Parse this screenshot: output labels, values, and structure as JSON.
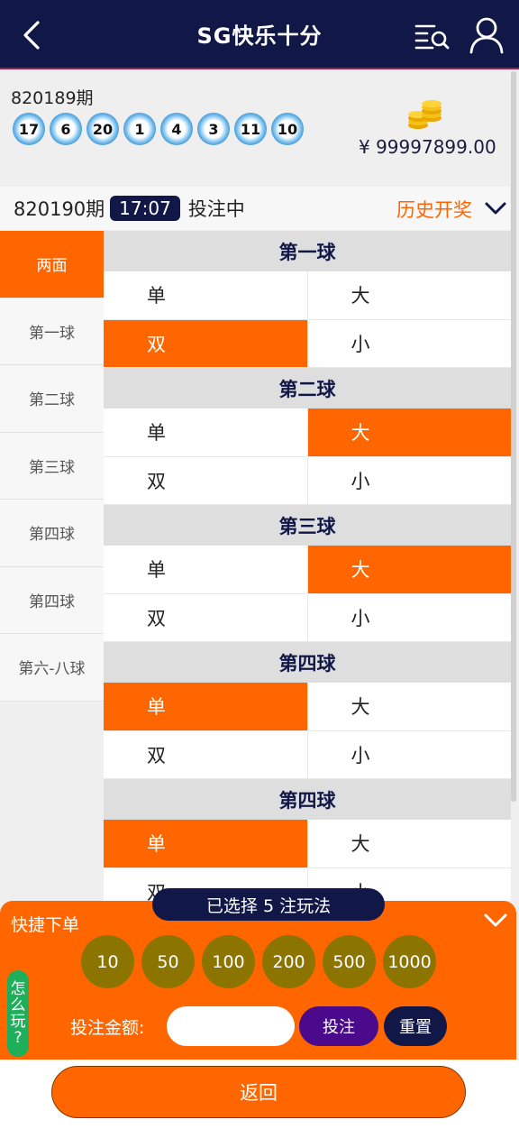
{
  "header": {
    "title": "SG快乐十分"
  },
  "last_draw": {
    "issue": "820189期",
    "balls": [
      "17",
      "6",
      "20",
      "1",
      "4",
      "3",
      "11",
      "10"
    ],
    "balance": "¥ 99997899.00"
  },
  "current": {
    "issue": "820190期",
    "timer": "17:07",
    "status": "投注中",
    "history_label": "历史开奖"
  },
  "nav": {
    "items": [
      {
        "label": "两面",
        "active": true
      },
      {
        "label": "第一球",
        "active": false
      },
      {
        "label": "第二球",
        "active": false
      },
      {
        "label": "第三球",
        "active": false
      },
      {
        "label": "第四球",
        "active": false
      },
      {
        "label": "第四球",
        "active": false
      },
      {
        "label": "第六-八球",
        "active": false
      }
    ]
  },
  "groups": [
    {
      "title": "第一球",
      "rows": [
        [
          {
            "label": "单",
            "selected": false
          },
          {
            "label": "大",
            "selected": false
          }
        ],
        [
          {
            "label": "双",
            "selected": true
          },
          {
            "label": "小",
            "selected": false
          }
        ]
      ]
    },
    {
      "title": "第二球",
      "rows": [
        [
          {
            "label": "单",
            "selected": false
          },
          {
            "label": "大",
            "selected": true
          }
        ],
        [
          {
            "label": "双",
            "selected": false
          },
          {
            "label": "小",
            "selected": false
          }
        ]
      ]
    },
    {
      "title": "第三球",
      "rows": [
        [
          {
            "label": "单",
            "selected": false
          },
          {
            "label": "大",
            "selected": true
          }
        ],
        [
          {
            "label": "双",
            "selected": false
          },
          {
            "label": "小",
            "selected": false
          }
        ]
      ]
    },
    {
      "title": "第四球",
      "rows": [
        [
          {
            "label": "单",
            "selected": true
          },
          {
            "label": "大",
            "selected": false
          }
        ],
        [
          {
            "label": "双",
            "selected": false
          },
          {
            "label": "小",
            "selected": false
          }
        ]
      ]
    },
    {
      "title": "第四球",
      "rows": [
        [
          {
            "label": "单",
            "selected": true
          },
          {
            "label": "大",
            "selected": false
          }
        ],
        [
          {
            "label": "双",
            "selected": false
          },
          {
            "label": "小",
            "selected": false
          }
        ]
      ]
    }
  ],
  "quick_bet": {
    "title": "快捷下单",
    "selected_pill": "已选择 5 注玩法",
    "chips": [
      "10",
      "50",
      "100",
      "200",
      "500",
      "1000"
    ],
    "howto": [
      "怎",
      "么",
      "玩",
      "?"
    ],
    "amount_label": "投注金额:",
    "amount_value": "",
    "bet_label": "投注",
    "reset_label": "重置"
  },
  "footer": {
    "back_label": "返回"
  },
  "colors": {
    "navy": "#111847",
    "orange": "#ff6600",
    "purple": "#4b0a8c",
    "chip": "#8b7400",
    "green": "#1fae5a"
  },
  "icons": {
    "back": "chevron-left-icon",
    "history": "list-search-icon",
    "user": "user-icon",
    "coins": "coin-stack-icon",
    "history_toggle": "chevron-down-icon",
    "collapse": "chevron-down-icon"
  }
}
